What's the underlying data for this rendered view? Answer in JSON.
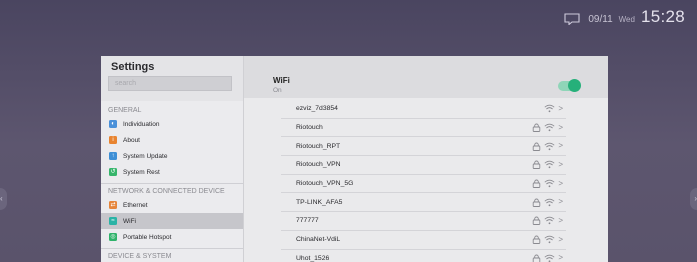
{
  "status_bar": {
    "date": "09/11",
    "weekday": "Wed",
    "time": "15:28",
    "icon": "message-icon"
  },
  "sidebar": {
    "title": "Settings",
    "search_placeholder": "search",
    "sections": [
      {
        "header": "GENERAL",
        "items": [
          {
            "label": "Individuation",
            "icon": "individuation-icon",
            "color": "#4a90d9"
          },
          {
            "label": "About",
            "icon": "about-icon",
            "color": "#e88430"
          },
          {
            "label": "System Update",
            "icon": "system-update-icon",
            "color": "#3d8fd6"
          },
          {
            "label": "System Rest",
            "icon": "system-rest-icon",
            "color": "#36b56b"
          }
        ]
      },
      {
        "header": "NETWORK & CONNECTED DEVICE",
        "items": [
          {
            "label": "Ethernet",
            "icon": "ethernet-icon",
            "color": "#e6853a"
          },
          {
            "label": "WiFi",
            "icon": "wifi-icon",
            "color": "#2ab3a6",
            "active": true
          },
          {
            "label": "Portable Hotspot",
            "icon": "hotspot-icon",
            "color": "#2fb26a"
          }
        ]
      },
      {
        "header": "DEVICE & SYSTEM",
        "items": []
      }
    ]
  },
  "wifi_panel": {
    "title": "WiFi",
    "status": "On",
    "toggle_on": true,
    "accent": "#26b07a",
    "networks": [
      {
        "ssid": "ezviz_7d3854",
        "locked": false
      },
      {
        "ssid": "Riotouch",
        "locked": true
      },
      {
        "ssid": "Riotouch_RPT",
        "locked": true
      },
      {
        "ssid": "Riotouch_VPN",
        "locked": true
      },
      {
        "ssid": "Riotouch_VPN_5G",
        "locked": true
      },
      {
        "ssid": "TP-LINK_AFA5",
        "locked": true
      },
      {
        "ssid": "777777",
        "locked": true
      },
      {
        "ssid": "ChinaNet-VdiL",
        "locked": true
      },
      {
        "ssid": "Uhot_1526",
        "locked": true
      }
    ]
  }
}
